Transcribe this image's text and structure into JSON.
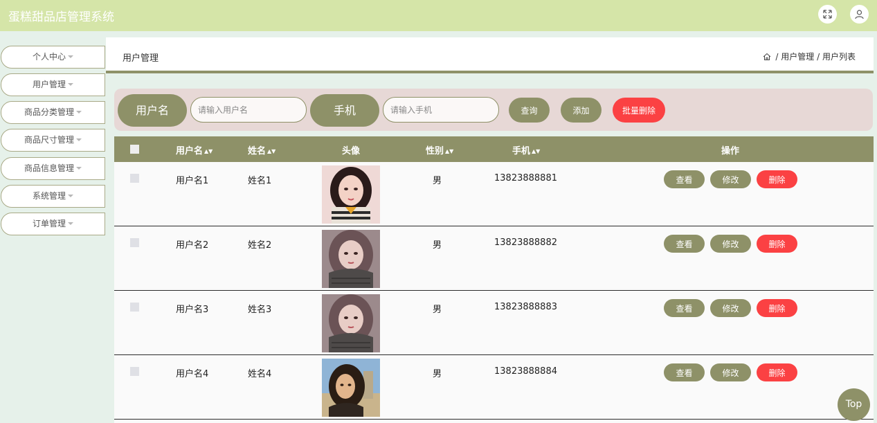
{
  "app": {
    "title": "蛋糕甜品店管理系统"
  },
  "topbar_icons": [
    "fullscreen-icon",
    "user-icon"
  ],
  "sidebar": {
    "items": [
      {
        "label": "个人中心"
      },
      {
        "label": "用户管理"
      },
      {
        "label": "商品分类管理"
      },
      {
        "label": "商品尺寸管理"
      },
      {
        "label": "商品信息管理"
      },
      {
        "label": "系统管理"
      },
      {
        "label": "订单管理"
      }
    ]
  },
  "page": {
    "title": "用户管理",
    "breadcrumb": [
      "用户管理",
      "用户列表"
    ],
    "breadcrumb_sep": "/"
  },
  "search": {
    "username_label": "用户名",
    "username_placeholder": "请输入用户名",
    "phone_label": "手机",
    "phone_placeholder": "请输入手机",
    "query_button": "查询",
    "add_button": "添加",
    "batch_delete_button": "批量删除"
  },
  "table": {
    "columns": [
      "用户名",
      "姓名",
      "头像",
      "性别",
      "手机",
      "操作"
    ],
    "sortable": [
      true,
      true,
      false,
      true,
      true,
      false
    ],
    "rows": [
      {
        "username": "用户名1",
        "name": "姓名1",
        "gender": "男",
        "phone": "13823888881"
      },
      {
        "username": "用户名2",
        "name": "姓名2",
        "gender": "男",
        "phone": "13823888882"
      },
      {
        "username": "用户名3",
        "name": "姓名3",
        "gender": "男",
        "phone": "13823888883"
      },
      {
        "username": "用户名4",
        "name": "姓名4",
        "gender": "男",
        "phone": "13823888884"
      }
    ],
    "row_actions": {
      "view": "查看",
      "edit": "修改",
      "delete": "删除"
    }
  },
  "back_to_top": "Top",
  "colors": {
    "topbar": "#d5e5a8",
    "accent": "#8e9168",
    "danger": "#fb4143",
    "search_panel": "#e7d8d6",
    "page_bg": "#e6f1ea"
  }
}
